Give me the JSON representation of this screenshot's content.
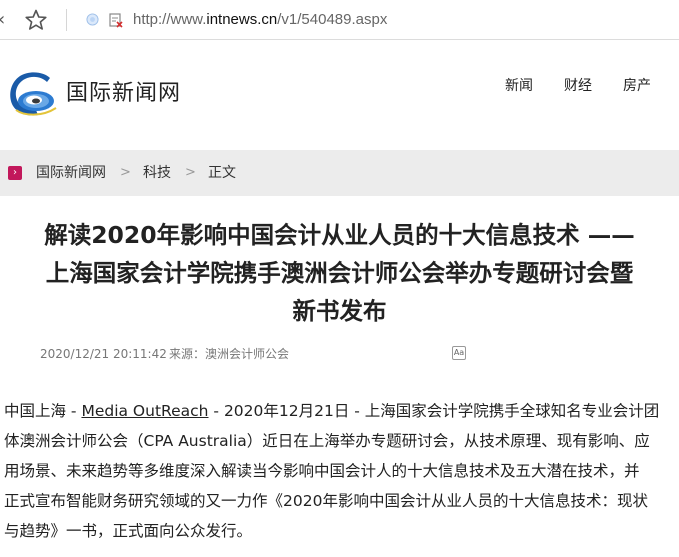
{
  "browser": {
    "url_prefix": "http://www.",
    "url_domain": "intnews.cn",
    "url_path": "/v1/540489.aspx"
  },
  "header": {
    "site_name": "国际新闻网",
    "nav": [
      "新闻",
      "财经",
      "房产"
    ]
  },
  "breadcrumb": {
    "items": [
      "国际新闻网",
      "科技",
      "正文"
    ],
    "separator": ">"
  },
  "article": {
    "title_lines": [
      "解读2020年影响中国会计从业人员的十大信息技术 ——",
      "上海国家会计学院携手澳洲会计师公会举办专题研讨会暨",
      "新书发布"
    ],
    "date": "2020/12/21 20:11:42",
    "source_label": "来源：",
    "source": "澳洲会计师公会",
    "body": {
      "l1_before": "中国上海 - ",
      "l1_link": "Media OutReach",
      "l1_after": " - 2020年12月21日 - 上海国家会计学院携手全球知名专业会计团",
      "l2": "体澳洲会计师公会（CPA Australia）近日在上海举办专题研讨会，从技术原理、现有影响、应",
      "l3": "用场景、未来趋势等多维度深入解读当今影响中国会计人的十大信息技术及五大潜在技术，并",
      "l4": "正式宣布智能财务研究领域的又一力作《2020年影响中国会计从业人员的十大信息技术：现状",
      "l5": "与趋势》一书，正式面向公众发行。"
    }
  }
}
